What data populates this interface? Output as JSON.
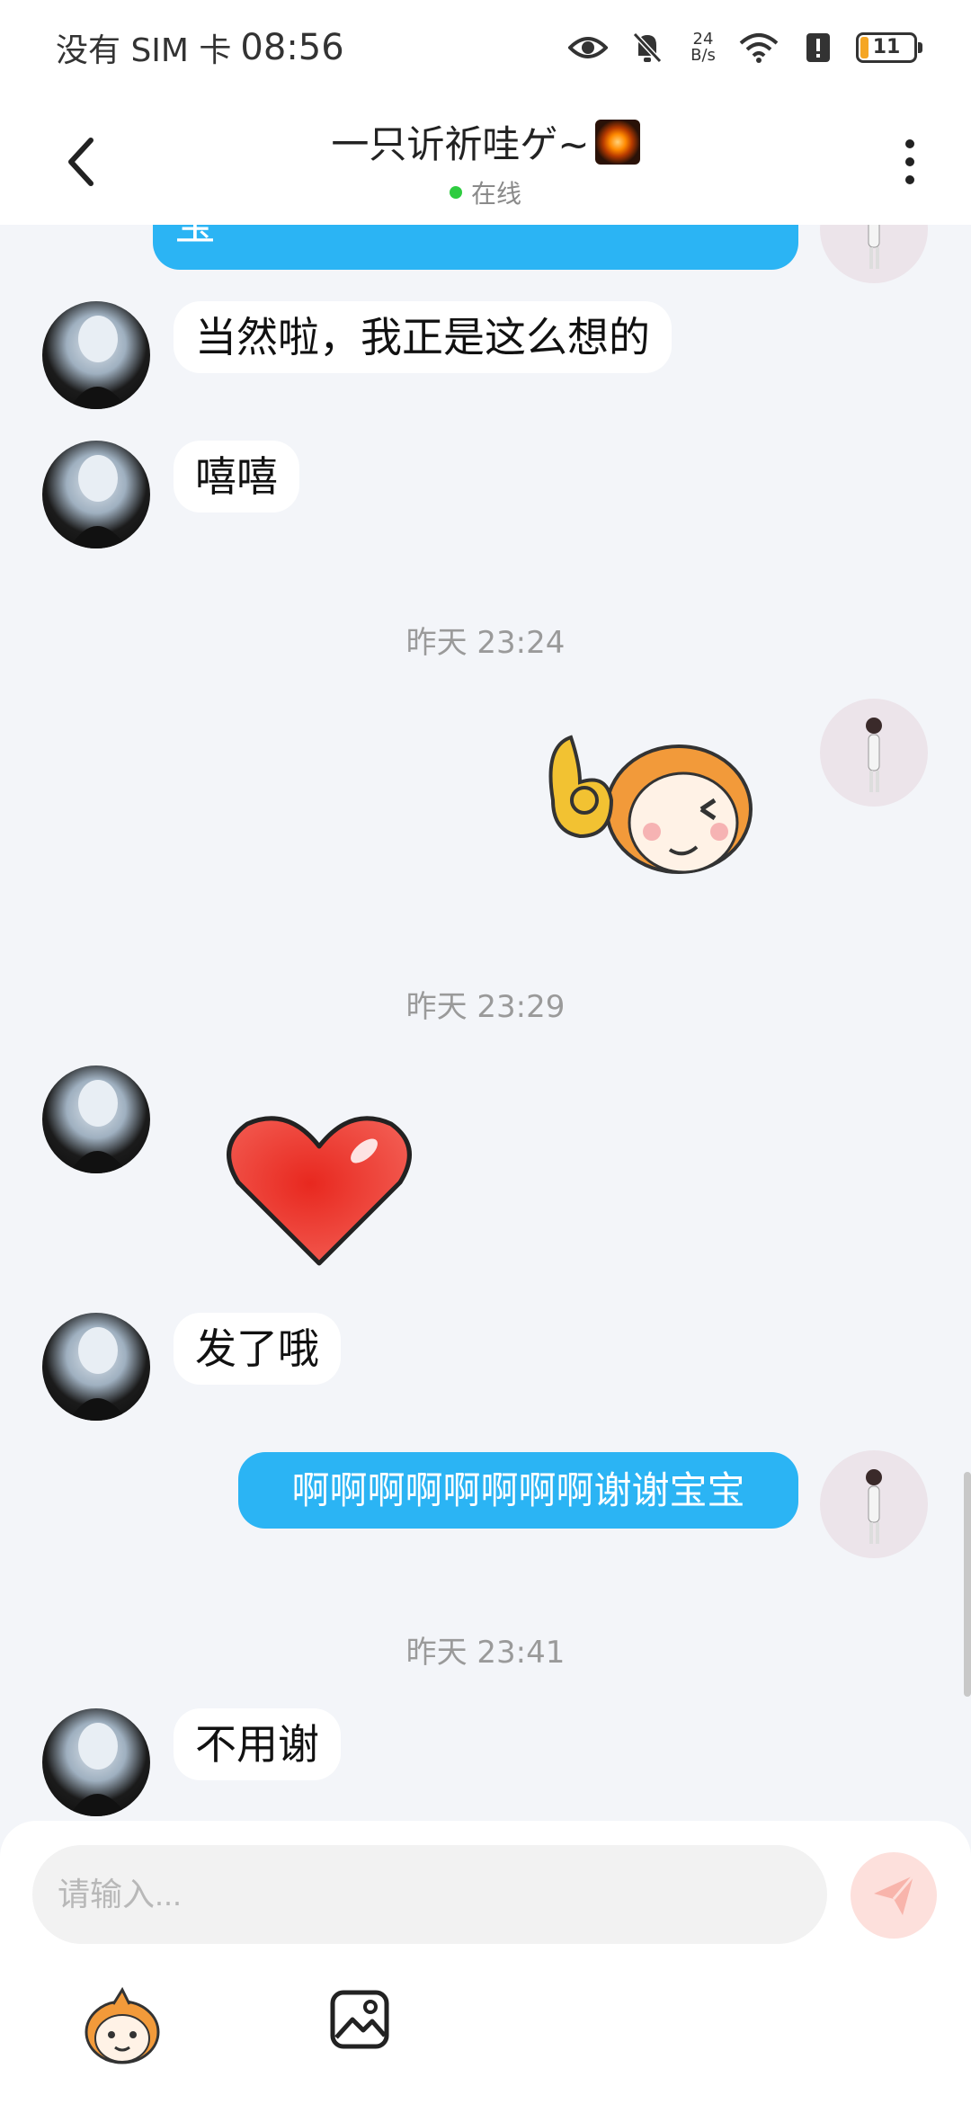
{
  "status_bar": {
    "carrier": "没有 SIM 卡",
    "time": "08:56",
    "net_speed_value": "24",
    "net_speed_unit": "B/s",
    "battery_level": "11",
    "icons": [
      "eye-icon",
      "bell-muted-icon",
      "wifi-icon",
      "alert-icon",
      "battery-icon"
    ]
  },
  "header": {
    "title": "一只䜣祈哇ゲ~",
    "status": "在线",
    "back_icon": "chevron-left-icon",
    "more_icon": "more-vertical-icon"
  },
  "messages": [
    {
      "from": "self",
      "type": "text",
      "text": "宝",
      "partial": true
    },
    {
      "from": "other",
      "type": "text",
      "text": "当然啦，我正是这么想的"
    },
    {
      "from": "other",
      "type": "text",
      "text": "嘻嘻"
    },
    {
      "type": "timestamp",
      "text": "昨天 23:24"
    },
    {
      "from": "self",
      "type": "sticker",
      "sticker": "ok-girl-sticker"
    },
    {
      "type": "timestamp",
      "text": "昨天 23:29"
    },
    {
      "from": "other",
      "type": "sticker",
      "sticker": "heart-sticker"
    },
    {
      "from": "other",
      "type": "text",
      "text": "发了哦"
    },
    {
      "from": "self",
      "type": "text",
      "text": "啊啊啊啊啊啊啊啊谢谢宝宝"
    },
    {
      "type": "timestamp",
      "text": "昨天 23:41"
    },
    {
      "from": "other",
      "type": "text",
      "text": "不用谢"
    }
  ],
  "input_bar": {
    "placeholder": "请输入...",
    "value": "",
    "send_icon": "send-icon",
    "tools": [
      "emoji-sticker-icon",
      "image-icon"
    ]
  },
  "colors": {
    "self_bubble": "#2bb4f4",
    "other_bubble": "#ffffff",
    "background": "#f3f5f9",
    "online": "#2ecc40",
    "send_button": "#fde0dc"
  }
}
